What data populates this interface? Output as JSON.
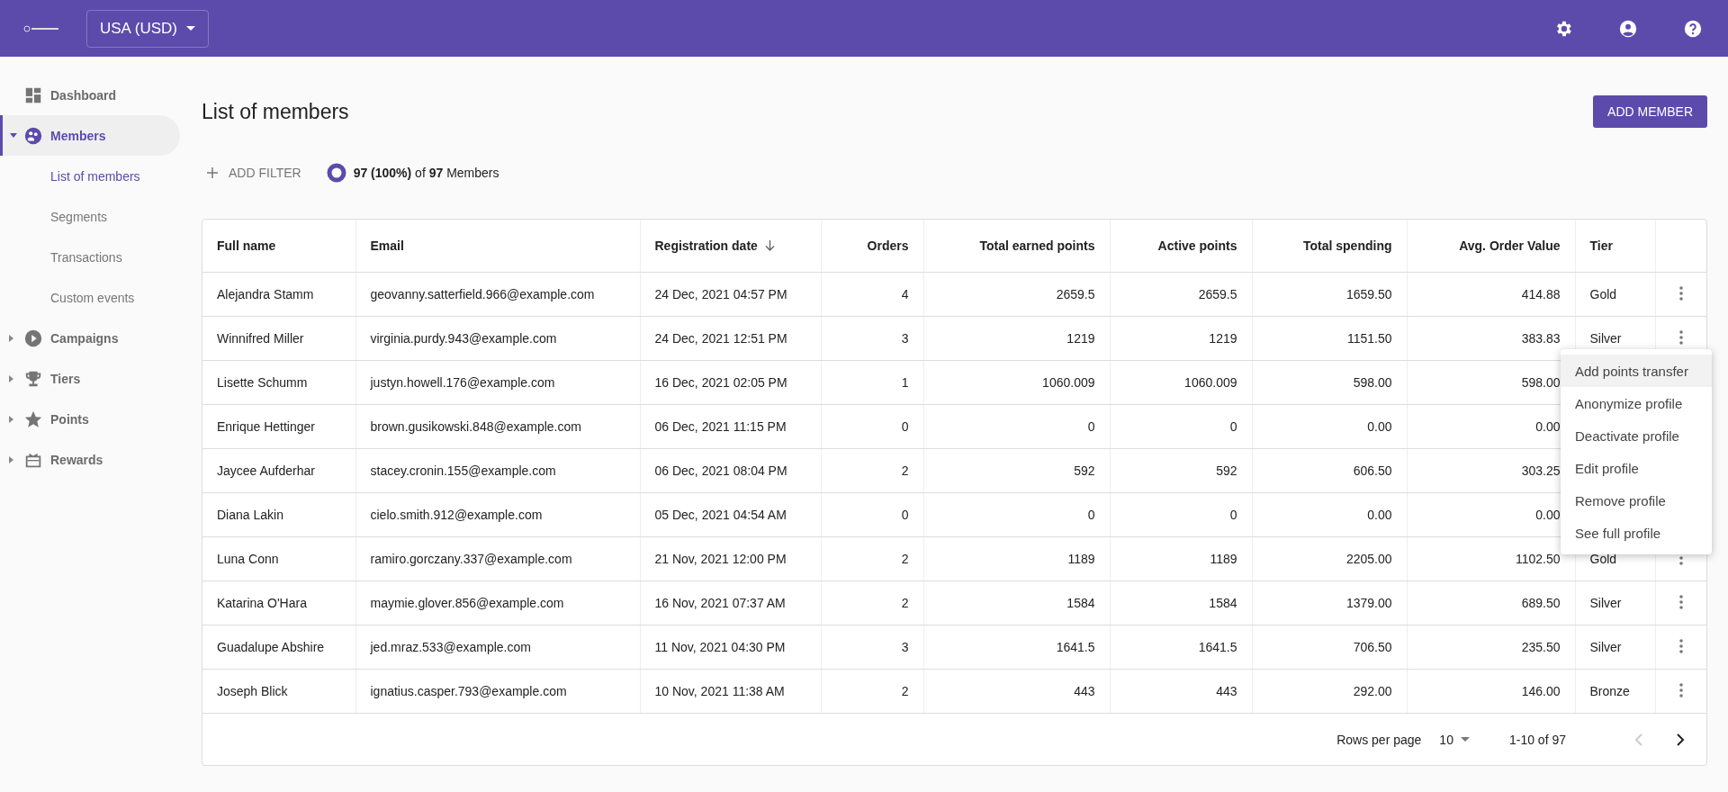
{
  "topbar": {
    "currency": "USA (USD)"
  },
  "sidebar": {
    "items": [
      {
        "label": "Dashboard",
        "selected": false
      },
      {
        "label": "Members",
        "selected": true,
        "expanded": true,
        "children": [
          {
            "label": "List of members",
            "selected": true
          },
          {
            "label": "Segments",
            "selected": false
          },
          {
            "label": "Transactions",
            "selected": false
          },
          {
            "label": "Custom events",
            "selected": false
          }
        ]
      },
      {
        "label": "Campaigns",
        "selected": false,
        "expanded": false
      },
      {
        "label": "Tiers",
        "selected": false,
        "expanded": false
      },
      {
        "label": "Points",
        "selected": false,
        "expanded": false
      },
      {
        "label": "Rewards",
        "selected": false,
        "expanded": false
      }
    ]
  },
  "page": {
    "title": "List of members",
    "add_button": "ADD MEMBER",
    "add_filter": "ADD FILTER",
    "summary": "**97 (100%)** of **97** Members"
  },
  "table": {
    "columns": [
      {
        "label": "Full name",
        "kind": "text",
        "sorted": false
      },
      {
        "label": "Email",
        "kind": "text",
        "sorted": false
      },
      {
        "label": "Registration date",
        "kind": "text",
        "sorted": true
      },
      {
        "label": "Orders",
        "kind": "number",
        "sorted": false
      },
      {
        "label": "Total earned points",
        "kind": "number",
        "sorted": false
      },
      {
        "label": "Active points",
        "kind": "number",
        "sorted": false
      },
      {
        "label": "Total spending",
        "kind": "number",
        "sorted": false
      },
      {
        "label": "Avg. Order Value",
        "kind": "number",
        "sorted": false
      },
      {
        "label": "Tier",
        "kind": "text",
        "sorted": false
      }
    ],
    "rows": [
      {
        "cells": [
          "Alejandra Stamm",
          "geovanny.satterfield.966@example.com",
          "24 Dec, 2021 04:57 PM",
          "4",
          "2659.5",
          "2659.5",
          "1659.50",
          "414.88"
        ],
        "tier": "Gold"
      },
      {
        "cells": [
          "Winnifred Miller",
          "virginia.purdy.943@example.com",
          "24 Dec, 2021 12:51 PM",
          "3",
          "1219",
          "1219",
          "1151.50",
          "383.83"
        ],
        "tier": "Silver"
      },
      {
        "cells": [
          "Lisette Schumm",
          "justyn.howell.176@example.com",
          "16 Dec, 2021 02:05 PM",
          "1",
          "1060.009",
          "1060.009",
          "598.00",
          "598.00"
        ]
      },
      {
        "cells": [
          "Enrique Hettinger",
          "brown.gusikowski.848@example.com",
          "06 Dec, 2021 11:15 PM",
          "0",
          "0",
          "0",
          "0.00",
          "0.00"
        ]
      },
      {
        "cells": [
          "Jaycee Aufderhar",
          "stacey.cronin.155@example.com",
          "06 Dec, 2021 08:04 PM",
          "2",
          "592",
          "592",
          "606.50",
          "303.25"
        ]
      },
      {
        "cells": [
          "Diana Lakin",
          "cielo.smith.912@example.com",
          "05 Dec, 2021 04:54 AM",
          "0",
          "0",
          "0",
          "0.00",
          "0.00"
        ]
      },
      {
        "cells": [
          "Luna Conn",
          "ramiro.gorczany.337@example.com",
          "21 Nov, 2021 12:00 PM",
          "2",
          "1189",
          "1189",
          "2205.00",
          "1102.50"
        ],
        "tier": "Gold"
      },
      {
        "cells": [
          "Katarina O'Hara",
          "maymie.glover.856@example.com",
          "16 Nov, 2021 07:37 AM",
          "2",
          "1584",
          "1584",
          "1379.00",
          "689.50"
        ],
        "tier": "Silver"
      },
      {
        "cells": [
          "Guadalupe Abshire",
          "jed.mraz.533@example.com",
          "11 Nov, 2021 04:30 PM",
          "3",
          "1641.5",
          "1641.5",
          "706.50",
          "235.50"
        ],
        "tier": "Silver"
      },
      {
        "cells": [
          "Joseph Blick",
          "ignatius.casper.793@example.com",
          "10 Nov, 2021 11:38 AM",
          "2",
          "443",
          "443",
          "292.00",
          "146.00"
        ],
        "tier": "Bronze"
      }
    ],
    "footer": {
      "rows_label": "Rows per page",
      "rows_value": "10",
      "range": "1-10 of 97",
      "prev_disabled": true,
      "next_disabled": false
    }
  },
  "context_menu": {
    "items": [
      {
        "label": "Add points transfer",
        "selected": true
      },
      {
        "label": "Anonymize profile",
        "selected": false
      },
      {
        "label": "Deactivate profile",
        "selected": false
      },
      {
        "label": "Edit profile",
        "selected": false
      },
      {
        "label": "Remove profile",
        "selected": false
      },
      {
        "label": "See full profile",
        "selected": false
      }
    ]
  }
}
